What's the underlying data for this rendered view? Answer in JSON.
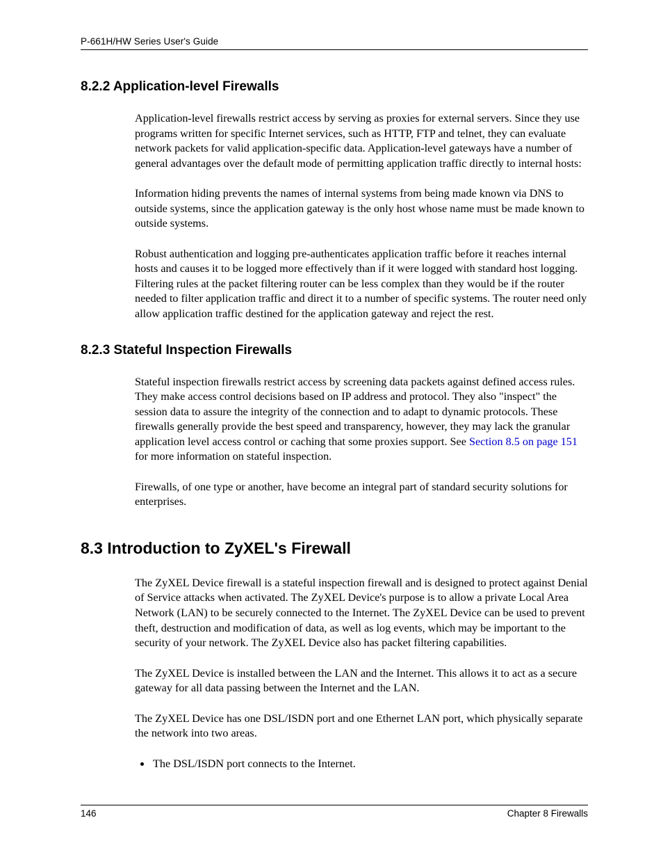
{
  "header": {
    "running_title": "P-661H/HW Series User's Guide"
  },
  "sections": {
    "s822": {
      "heading": "8.2.2  Application-level Firewalls",
      "p1": "Application-level firewalls restrict access by serving as proxies for external servers. Since they use programs written for specific Internet services, such as HTTP, FTP and telnet, they can evaluate network packets for valid application-specific data. Application-level gateways have a number of general advantages over the default mode of permitting application traffic directly to internal hosts:",
      "p2": "Information hiding prevents the names of internal systems from being made known via DNS to outside systems, since the application gateway is the only host whose name must be made known to outside systems.",
      "p3": "Robust authentication and logging pre-authenticates application traffic before it reaches internal hosts and causes it to be logged more effectively than if it were logged with standard host logging. Filtering rules at the packet filtering router can be less complex than they would be if the router needed to filter application traffic and direct it to a number of specific systems. The router need only allow application traffic destined for the application gateway and reject the rest."
    },
    "s823": {
      "heading": "8.2.3  Stateful Inspection Firewalls",
      "p1_pre": "Stateful inspection firewalls restrict access by screening data packets against defined access rules. They make access control decisions based on IP address and protocol. They also \"inspect\" the session data to assure the integrity of the connection and to adapt to dynamic protocols. These firewalls generally provide the best speed and transparency, however, they may lack the granular application level access control or caching that some proxies support. See ",
      "p1_link": "Section 8.5 on page 151",
      "p1_post": " for more information on stateful inspection.",
      "p2": "Firewalls, of one type or another, have become an integral part of standard security solutions for enterprises."
    },
    "s83": {
      "heading": "8.3  Introduction to ZyXEL's Firewall",
      "p1": "The ZyXEL Device firewall is a stateful inspection firewall and is designed to protect against Denial of Service attacks when activated. The ZyXEL Device's purpose is to allow a private Local Area Network (LAN) to be securely connected to the Internet. The ZyXEL Device can be used to prevent theft, destruction and modification of data, as well as log events, which may be important to the security of your network. The ZyXEL Device also has packet filtering capabilities.",
      "p2": "The ZyXEL Device is installed between the LAN and the Internet. This allows it to act as a secure gateway for all data passing between the Internet and the LAN.",
      "p3": "The ZyXEL Device has one DSL/ISDN port and one Ethernet LAN port, which physically separate the network into two areas.",
      "bullet1": "The DSL/ISDN port connects to the Internet."
    }
  },
  "footer": {
    "page_number": "146",
    "chapter": "Chapter 8 Firewalls"
  }
}
